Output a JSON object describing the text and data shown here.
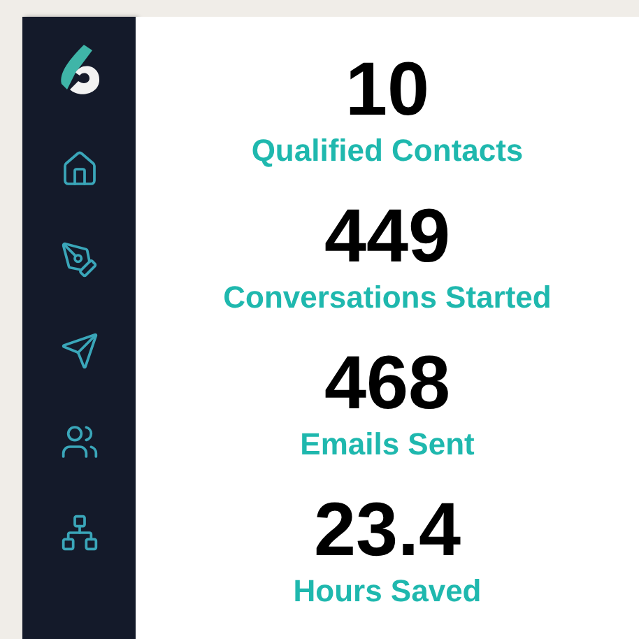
{
  "sidebar": {
    "items": [
      {
        "kind": "home"
      },
      {
        "kind": "pen"
      },
      {
        "kind": "send"
      },
      {
        "kind": "users"
      },
      {
        "kind": "network"
      }
    ]
  },
  "stats": [
    {
      "value": "10",
      "label": "Qualified Contacts"
    },
    {
      "value": "449",
      "label": "Conversations Started"
    },
    {
      "value": "468",
      "label": "Emails Sent"
    },
    {
      "value": "23.4",
      "label": "Hours Saved"
    }
  ]
}
